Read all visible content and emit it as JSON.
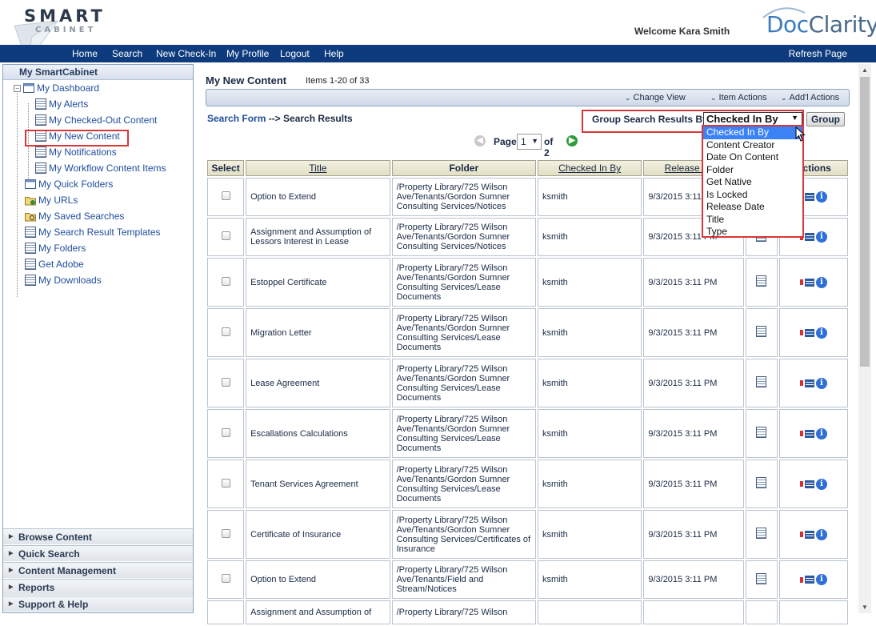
{
  "header": {
    "logo_smart": "SMART",
    "logo_cabinet": "CABINET",
    "welcome": "Welcome Kara Smith",
    "brand_doc": "Doc",
    "brand_clarity": "Clarity"
  },
  "nav": {
    "items": [
      "Home",
      "Search",
      "New Check-In",
      "My Profile",
      "Logout",
      "Help"
    ],
    "refresh": "Refresh Page"
  },
  "sidebar": {
    "title": "My SmartCabinet",
    "tree": [
      "My Dashboard",
      "My Alerts",
      "My Checked-Out Content",
      "My New Content",
      "My Notifications",
      "My Workflow Content Items",
      "My Quick Folders",
      "My URLs",
      "My Saved Searches",
      "My Search Result Templates",
      "My Folders",
      "Get Adobe",
      "My Downloads"
    ],
    "accordion": [
      "Browse Content",
      "Quick Search",
      "Content Management",
      "Reports",
      "Support & Help"
    ]
  },
  "main": {
    "title": "My New Content",
    "items_count": "Items 1-20 of 33",
    "toolbar": {
      "change_view": "Change View",
      "item_actions": "Item Actions",
      "addl_actions": "Add'l Actions"
    },
    "breadcrumb_link": "Search Form",
    "breadcrumb_rest": " --> Search Results",
    "group_label": "Group Search Results By:",
    "group_selected": "Checked In By",
    "group_button": "Group",
    "group_options": [
      "Checked In By",
      "Content Creator",
      "Date On Content",
      "Folder",
      "Get Native",
      "Is Locked",
      "Release Date",
      "Title",
      "Type"
    ],
    "pager": {
      "label": "Page",
      "current": "1",
      "of": "of 2"
    },
    "columns": [
      "Select",
      "Title",
      "Folder",
      "Checked In By",
      "Release Date",
      "",
      "Actions"
    ],
    "rows": [
      {
        "title": "Option to Extend",
        "folder": "/Property Library/725 Wilson Ave/Tenants/Gordon Sumner Consulting Services/Notices",
        "by": "ksmith",
        "date": "9/3/2015 3:11 PM"
      },
      {
        "title": "Assignment and Assumption of Lessors Interest in Lease",
        "folder": "/Property Library/725 Wilson Ave/Tenants/Gordon Sumner Consulting Services/Notices",
        "by": "ksmith",
        "date": "9/3/2015 3:11 PM"
      },
      {
        "title": "Estoppel Certificate",
        "folder": "/Property Library/725 Wilson Ave/Tenants/Gordon Sumner Consulting Services/Lease Documents",
        "by": "ksmith",
        "date": "9/3/2015 3:11 PM"
      },
      {
        "title": "Migration Letter",
        "folder": "/Property Library/725 Wilson Ave/Tenants/Gordon Sumner Consulting Services/Lease Documents",
        "by": "ksmith",
        "date": "9/3/2015 3:11 PM"
      },
      {
        "title": "Lease Agreement",
        "folder": "/Property Library/725 Wilson Ave/Tenants/Gordon Sumner Consulting Services/Lease Documents",
        "by": "ksmith",
        "date": "9/3/2015 3:11 PM"
      },
      {
        "title": "Escallations Calculations",
        "folder": "/Property Library/725 Wilson Ave/Tenants/Gordon Sumner Consulting Services/Lease Documents",
        "by": "ksmith",
        "date": "9/3/2015 3:11 PM"
      },
      {
        "title": "Tenant Services Agreement",
        "folder": "/Property Library/725 Wilson Ave/Tenants/Gordon Sumner Consulting Services/Lease Documents",
        "by": "ksmith",
        "date": "9/3/2015 3:11 PM"
      },
      {
        "title": "Certificate of Insurance",
        "folder": "/Property Library/725 Wilson Ave/Tenants/Gordon Sumner Consulting Services/Certificates of Insurance",
        "by": "ksmith",
        "date": "9/3/2015 3:11 PM"
      },
      {
        "title": "Option to Extend",
        "folder": "/Property Library/725 Wilson Ave/Tenants/Field and Stream/Notices",
        "by": "ksmith",
        "date": "9/3/2015 3:11 PM"
      },
      {
        "title": "Assignment and Assumption of",
        "folder": "/Property Library/725 Wilson",
        "by": "",
        "date": ""
      }
    ]
  }
}
